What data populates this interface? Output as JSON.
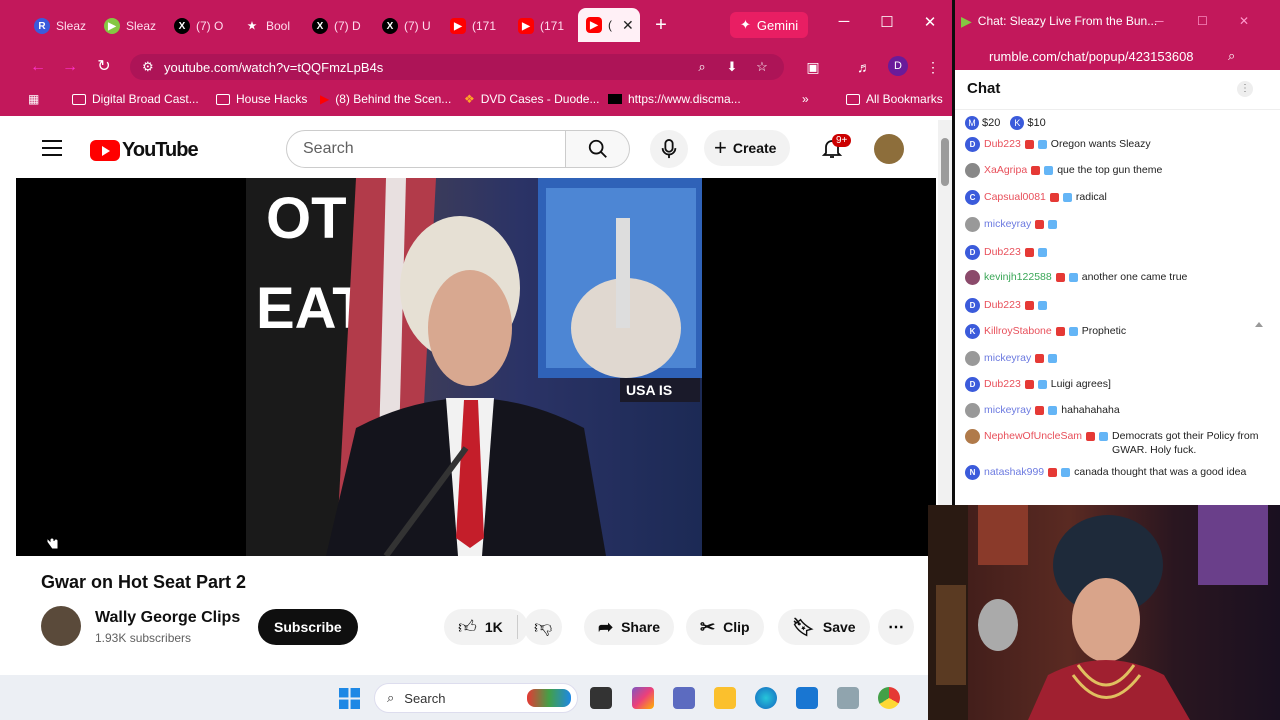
{
  "browser": {
    "tabs": [
      {
        "label": "Sleaz",
        "icon": "R",
        "color": "#3b5bdb"
      },
      {
        "label": "Sleaz",
        "icon": "▶",
        "color": "#85c742"
      },
      {
        "label": "(7) O",
        "icon": "X",
        "color": "#000000"
      },
      {
        "label": "Bool",
        "icon": "★",
        "color": "#c2185b"
      },
      {
        "label": "(7) D",
        "icon": "X",
        "color": "#000000"
      },
      {
        "label": "(7) U",
        "icon": "X",
        "color": "#000000"
      },
      {
        "label": "(171",
        "icon": "▶",
        "color": "#ff0000"
      },
      {
        "label": "(171",
        "icon": "▶",
        "color": "#ff0000"
      },
      {
        "label": "(",
        "icon": "▶",
        "color": "#ff0000"
      }
    ],
    "gemini_label": "Gemini",
    "url": "youtube.com/watch?v=tQQFmzLpB4s",
    "profile_initial": "D",
    "bookmarks": [
      {
        "label": "Digital Broad Cast..."
      },
      {
        "label": "House Hacks"
      },
      {
        "label": "(8) Behind the Scen..."
      },
      {
        "label": "DVD Cases - Duode..."
      },
      {
        "label": "https://www.discma..."
      }
    ],
    "all_bookmarks": "All Bookmarks"
  },
  "youtube": {
    "logo_text": "YouTube",
    "search_placeholder": "Search",
    "create_label": "Create",
    "notif_badge": "9+",
    "video_title": "Gwar on Hot Seat Part 2",
    "channel_name": "Wally George Clips",
    "subscribers": "1.93K subscribers",
    "subscribe_label": "Subscribe",
    "like_count": "1K",
    "share_label": "Share",
    "clip_label": "Clip",
    "save_label": "Save",
    "video_overlay_left": "OT\nEAT",
    "video_overlay_sign": "USA IS"
  },
  "rumble": {
    "window_title": "Chat: Sleazy Live From the Bun...",
    "url": "rumble.com/chat/popup/423153608",
    "chat_heading": "Chat",
    "tips": [
      {
        "label": "$20",
        "icon": "M"
      },
      {
        "label": "$10",
        "icon": "K"
      }
    ],
    "messages": [
      {
        "user": "Dub223",
        "text": "Oregon wants Sleazy",
        "color": "#e8505b",
        "av": "D",
        "avcolor": "#3b5bdb"
      },
      {
        "user": "XaAgripa",
        "text": "que the top gun theme",
        "color": "#e8505b",
        "av": "",
        "avcolor": "#888888"
      },
      {
        "user": "Capsual0081",
        "text": "radical",
        "color": "#e8505b",
        "av": "C",
        "avcolor": "#3b5bdb"
      },
      {
        "user": "mickeyray",
        "text": "",
        "color": "#6c7ae0",
        "av": "",
        "avcolor": "#999999"
      },
      {
        "user": "Dub223",
        "text": "",
        "color": "#e8505b",
        "av": "D",
        "avcolor": "#3b5bdb"
      },
      {
        "user": "kevinjh122588",
        "text": "another one came true",
        "color": "#3aa757",
        "av": "",
        "avcolor": "#8b4a6b"
      },
      {
        "user": "Dub223",
        "text": "",
        "color": "#e8505b",
        "av": "D",
        "avcolor": "#3b5bdb"
      },
      {
        "user": "KillroyStabone",
        "text": "Prophetic",
        "color": "#e8505b",
        "av": "K",
        "avcolor": "#3b5bdb"
      },
      {
        "user": "mickeyray",
        "text": "",
        "color": "#6c7ae0",
        "av": "",
        "avcolor": "#999999"
      },
      {
        "user": "Dub223",
        "text": "Luigi agrees]",
        "color": "#e8505b",
        "av": "D",
        "avcolor": "#3b5bdb"
      },
      {
        "user": "mickeyray",
        "text": "hahahahaha",
        "color": "#6c7ae0",
        "av": "",
        "avcolor": "#999999"
      },
      {
        "user": "NephewOfUncleSam",
        "text": "Democrats got their Policy from GWAR. Holy fuck.",
        "color": "#e8505b",
        "av": "",
        "avcolor": "#b07a4a"
      },
      {
        "user": "natashak999",
        "text": "canada thought that was a good idea",
        "color": "#6c7ae0",
        "av": "N",
        "avcolor": "#3b5bdb"
      }
    ]
  },
  "taskbar": {
    "search_label": "Search"
  }
}
